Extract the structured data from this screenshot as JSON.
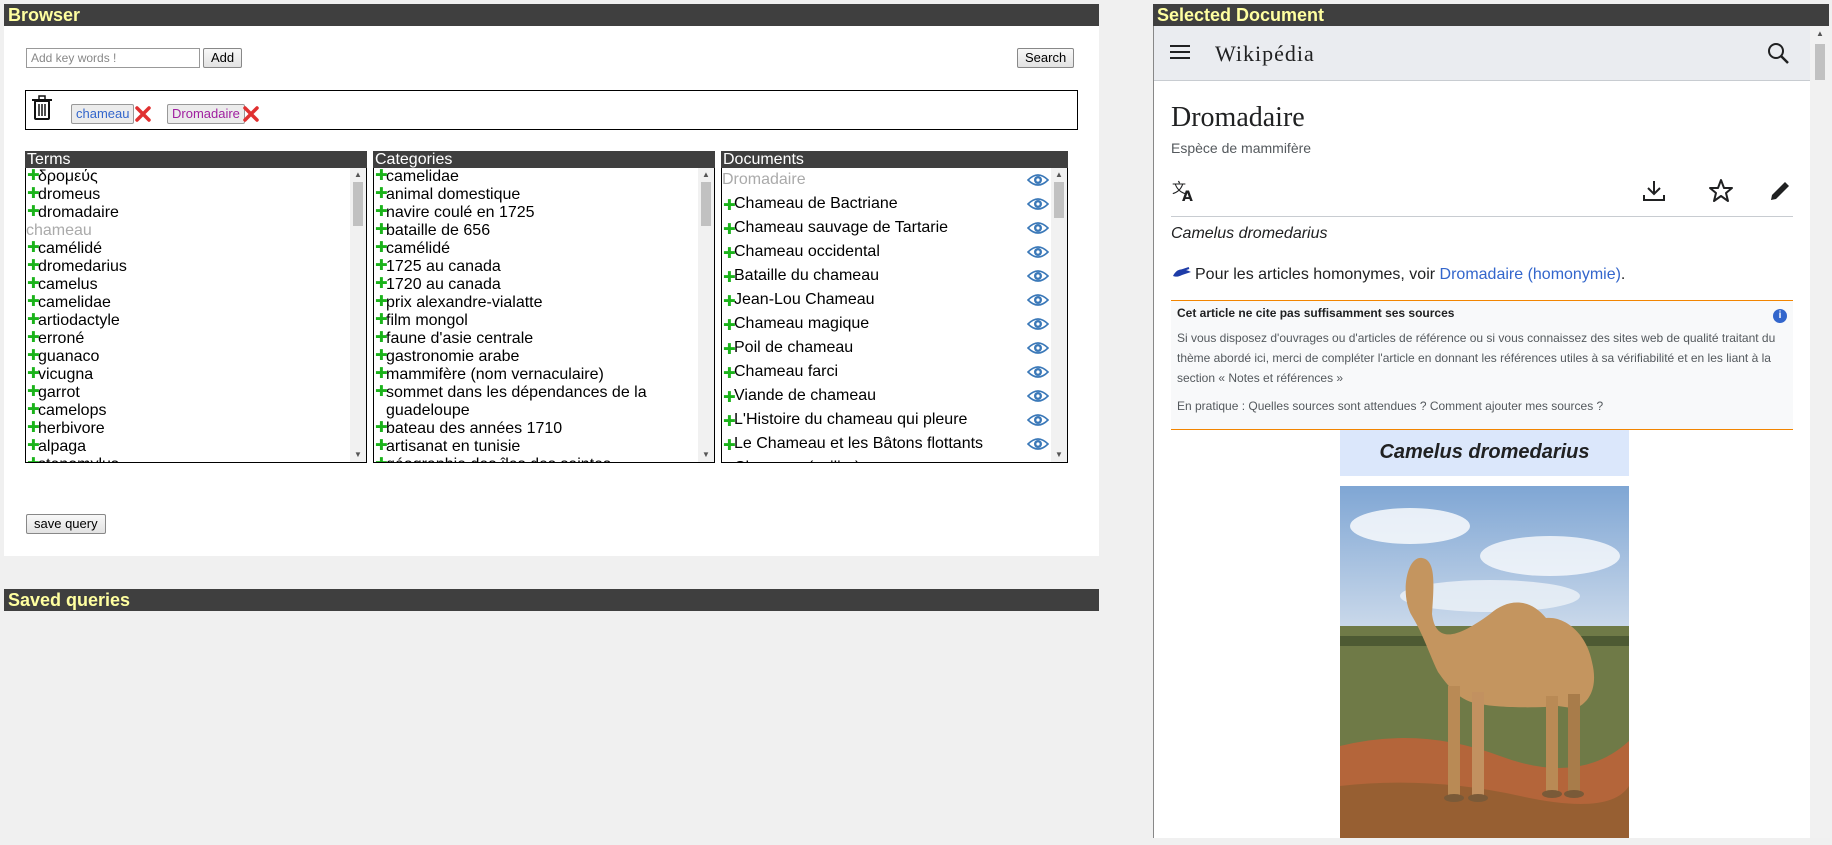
{
  "browser": {
    "title": "Browser",
    "keyword_placeholder": "Add key words !",
    "add_label": "Add",
    "search_label": "Search",
    "save_label": "save query",
    "tags": [
      "chameau",
      "Dromadaire"
    ],
    "tag_colors": [
      "#3366cc",
      "#a020a0"
    ],
    "terms_header": "Terms",
    "categories_header": "Categories",
    "documents_header": "Documents",
    "terms": [
      {
        "text": "δρομεύς",
        "muted": false
      },
      {
        "text": "dromeus",
        "muted": false
      },
      {
        "text": "dromadaire",
        "muted": false
      },
      {
        "text": "chameau",
        "muted": true
      },
      {
        "text": "camélidé",
        "muted": false
      },
      {
        "text": "dromedarius",
        "muted": false
      },
      {
        "text": "camelus",
        "muted": false
      },
      {
        "text": "camelidae",
        "muted": false
      },
      {
        "text": "artiodactyle",
        "muted": false
      },
      {
        "text": "erroné",
        "muted": false
      },
      {
        "text": "guanaco",
        "muted": false
      },
      {
        "text": "vicugna",
        "muted": false
      },
      {
        "text": "garrot",
        "muted": false
      },
      {
        "text": "camelops",
        "muted": false
      },
      {
        "text": "herbivore",
        "muted": false
      },
      {
        "text": "alpaga",
        "muted": false
      },
      {
        "text": "stenomylus",
        "muted": false
      }
    ],
    "categories": [
      "camelidae",
      "animal domestique",
      "navire coulé en 1725",
      "bataille de 656",
      "camélidé",
      "1725 au canada",
      "1720 au canada",
      "prix alexandre-vialatte",
      "film mongol",
      "faune d'asie centrale",
      "gastronomie arabe",
      "mammifère (nom vernaculaire)",
      "sommet dans les dépendances de la guadeloupe",
      "bateau des années 1710",
      "artisanat en tunisie",
      "géographie des îles des saintes"
    ],
    "documents": [
      {
        "text": "Dromadaire",
        "muted": true
      },
      {
        "text": "Chameau de Bactriane",
        "muted": false
      },
      {
        "text": "Chameau sauvage de Tartarie",
        "muted": false
      },
      {
        "text": "Chameau occidental",
        "muted": false
      },
      {
        "text": "Bataille du chameau",
        "muted": false
      },
      {
        "text": "Jean-Lou Chameau",
        "muted": false
      },
      {
        "text": "Chameau magique",
        "muted": false
      },
      {
        "text": "Poil de chameau",
        "muted": false
      },
      {
        "text": "Chameau farci",
        "muted": false
      },
      {
        "text": "Viande de chameau",
        "muted": false
      },
      {
        "text": "L'Histoire du chameau qui pleure",
        "muted": false
      },
      {
        "text": "Le Chameau et les Bâtons flottants",
        "muted": false
      },
      {
        "text": "Chameau (voilier)",
        "muted": false
      }
    ],
    "terms_scroll": 0.12,
    "categories_scroll": 0.1,
    "documents_scroll": 0.1
  },
  "saved": {
    "title": "Saved queries"
  },
  "document": {
    "panel_title": "Selected Document",
    "logo": "Wikipédia",
    "page_title": "Dromadaire",
    "subtitle": "Espèce de mammifère",
    "scientific_name": "Camelus dromedarius",
    "homonym_prefix": "Pour les articles homonymes, voir ",
    "homonym_link": "Dromadaire (homonymie)",
    "homonym_suffix": ".",
    "notice_title": "Cet article ne cite pas suffisamment ses sources",
    "notice_body": "Si vous disposez d'ouvrages ou d'articles de référence ou si vous connaissez des sites web de qualité traitant du thème abordé ici, merci de compléter l'article en donnant les références utiles à sa vérifiabilité et en les liant à la section « Notes et références »",
    "notice_footer": "En pratique : Quelles sources sont attendues ? Comment ajouter mes sources ?",
    "infobox_title": "Camelus dromedarius"
  },
  "colors": {
    "bar": "#3f3f3f",
    "bar_text": "#ffffa0",
    "plus": "#1bb31b",
    "remove": "#e03030",
    "link": "#3366cc"
  }
}
